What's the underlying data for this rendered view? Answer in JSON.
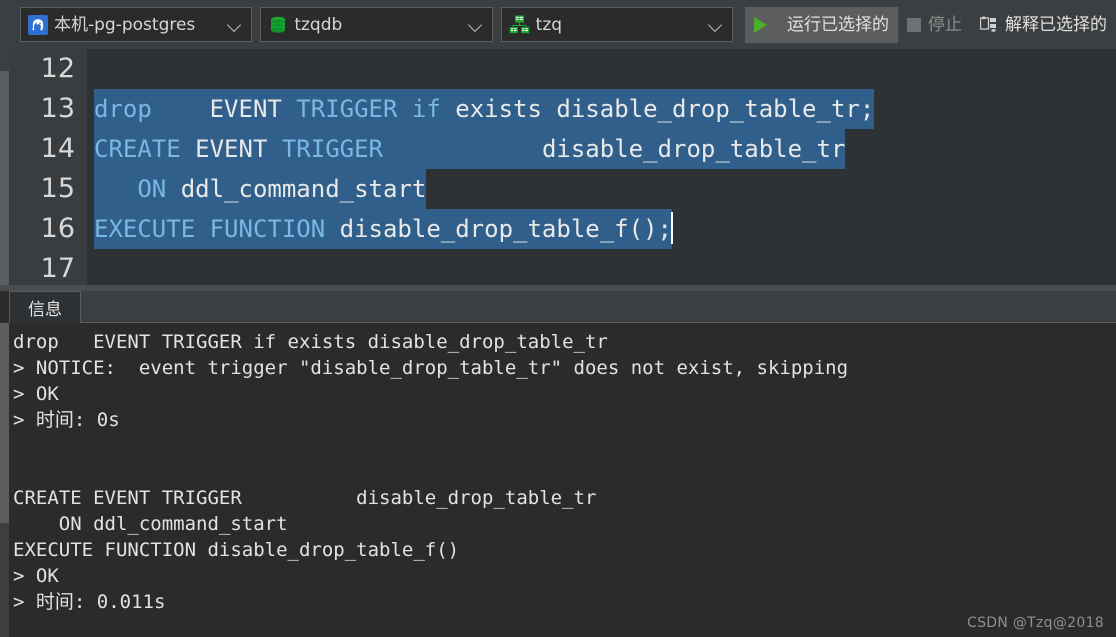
{
  "toolbar": {
    "connection": {
      "icon": "postgres-elephant-icon",
      "label": "本机-pg-postgres"
    },
    "database": {
      "icon": "database-cylinder-icon",
      "label": "tzqdb"
    },
    "schema": {
      "icon": "schema-tree-icon",
      "label": "tzq"
    },
    "run_selected": {
      "icon": "play-triangle-icon",
      "label": "运行已选择的"
    },
    "stop": {
      "icon": "stop-square-icon",
      "label": "停止",
      "enabled": false
    },
    "explain_selected": {
      "icon": "explain-plan-icon",
      "label": "解释已选择的"
    }
  },
  "editor": {
    "first_line_number": 12,
    "lines": [
      {
        "num": "12",
        "selected": false,
        "tokens": []
      },
      {
        "num": "13",
        "selected": true,
        "tokens": [
          {
            "t": "drop",
            "c": "kw"
          },
          {
            "t": "    ",
            "c": "id"
          },
          {
            "t": "EVENT",
            "c": "id"
          },
          {
            "t": " ",
            "c": "id"
          },
          {
            "t": "TRIGGER",
            "c": "kw"
          },
          {
            "t": " ",
            "c": "id"
          },
          {
            "t": "if",
            "c": "kw"
          },
          {
            "t": " exists disable_drop_table_tr;",
            "c": "id"
          }
        ]
      },
      {
        "num": "14",
        "selected": true,
        "tokens": [
          {
            "t": "CREATE",
            "c": "kw"
          },
          {
            "t": " EVENT ",
            "c": "id"
          },
          {
            "t": "TRIGGER",
            "c": "kw"
          },
          {
            "t": "           disable_drop_table_tr",
            "c": "id"
          }
        ]
      },
      {
        "num": "15",
        "selected": true,
        "tokens": [
          {
            "t": "   ",
            "c": "id"
          },
          {
            "t": "ON",
            "c": "kw"
          },
          {
            "t": " ddl_command_start",
            "c": "id"
          }
        ]
      },
      {
        "num": "16",
        "selected": true,
        "caret": true,
        "tokens": [
          {
            "t": "EXECUTE FUNCTION",
            "c": "kw"
          },
          {
            "t": " disable_drop_table_f();",
            "c": "id"
          }
        ]
      },
      {
        "num": "17",
        "selected": false,
        "tokens": []
      }
    ]
  },
  "panel": {
    "tabs": [
      {
        "label": "信息",
        "active": true
      }
    ]
  },
  "output": {
    "lines": [
      "drop   EVENT TRIGGER if exists disable_drop_table_tr",
      "> NOTICE:  event trigger \"disable_drop_table_tr\" does not exist, skipping",
      "> OK",
      "> 时间: 0s",
      "",
      "",
      "CREATE EVENT TRIGGER          disable_drop_table_tr",
      "    ON ddl_command_start",
      "EXECUTE FUNCTION disable_drop_table_f()",
      "> OK",
      "> 时间: 0.011s"
    ]
  },
  "watermark": {
    "text": "CSDN @Tzq@2018"
  },
  "colors": {
    "toolbar_bg": "#3c3f41",
    "editor_bg": "#2f3234",
    "gutter_bg": "#3a3d3f",
    "output_bg": "#2b2b2b",
    "selection": "#2f5f8a",
    "keyword": "#79b8e0",
    "identifier": "#e9e9e9",
    "accent_green": "#4caf28",
    "pg_blue": "#2f6fd0"
  }
}
